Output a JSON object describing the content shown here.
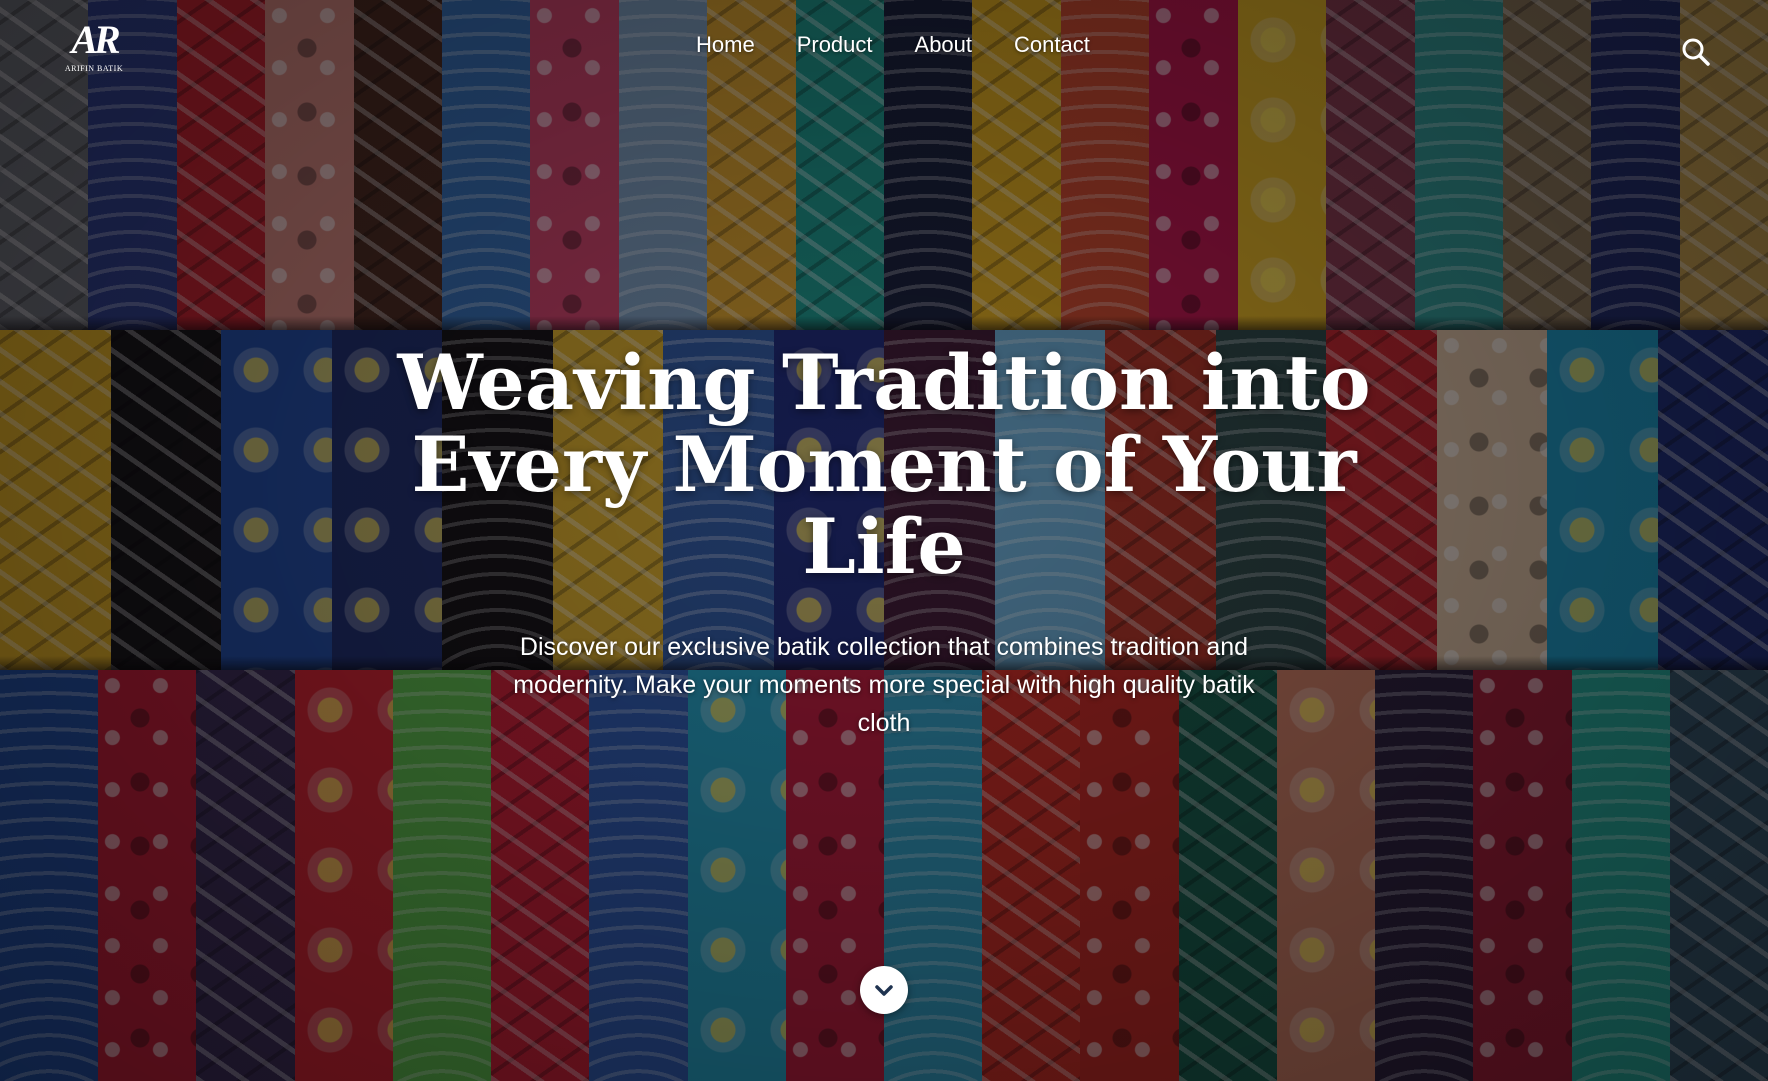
{
  "brand": {
    "logo_mark": "AR",
    "logo_text": "Arifin Batik"
  },
  "nav": {
    "items": [
      {
        "label": "Home"
      },
      {
        "label": "Product"
      },
      {
        "label": "About"
      },
      {
        "label": "Contact"
      }
    ],
    "search_icon": "search-icon"
  },
  "hero": {
    "title": "Weaving Tradition into Every Moment of Your Life",
    "subtitle": "Discover our exclusive batik collection that combines tradition and modernity. Make your moments more special with high quality batik cloth",
    "scroll_icon": "chevron-down-icon"
  },
  "colors": {
    "text": "#ffffff",
    "scroll_button_bg": "#ffffff",
    "scroll_icon": "#1f3350"
  }
}
